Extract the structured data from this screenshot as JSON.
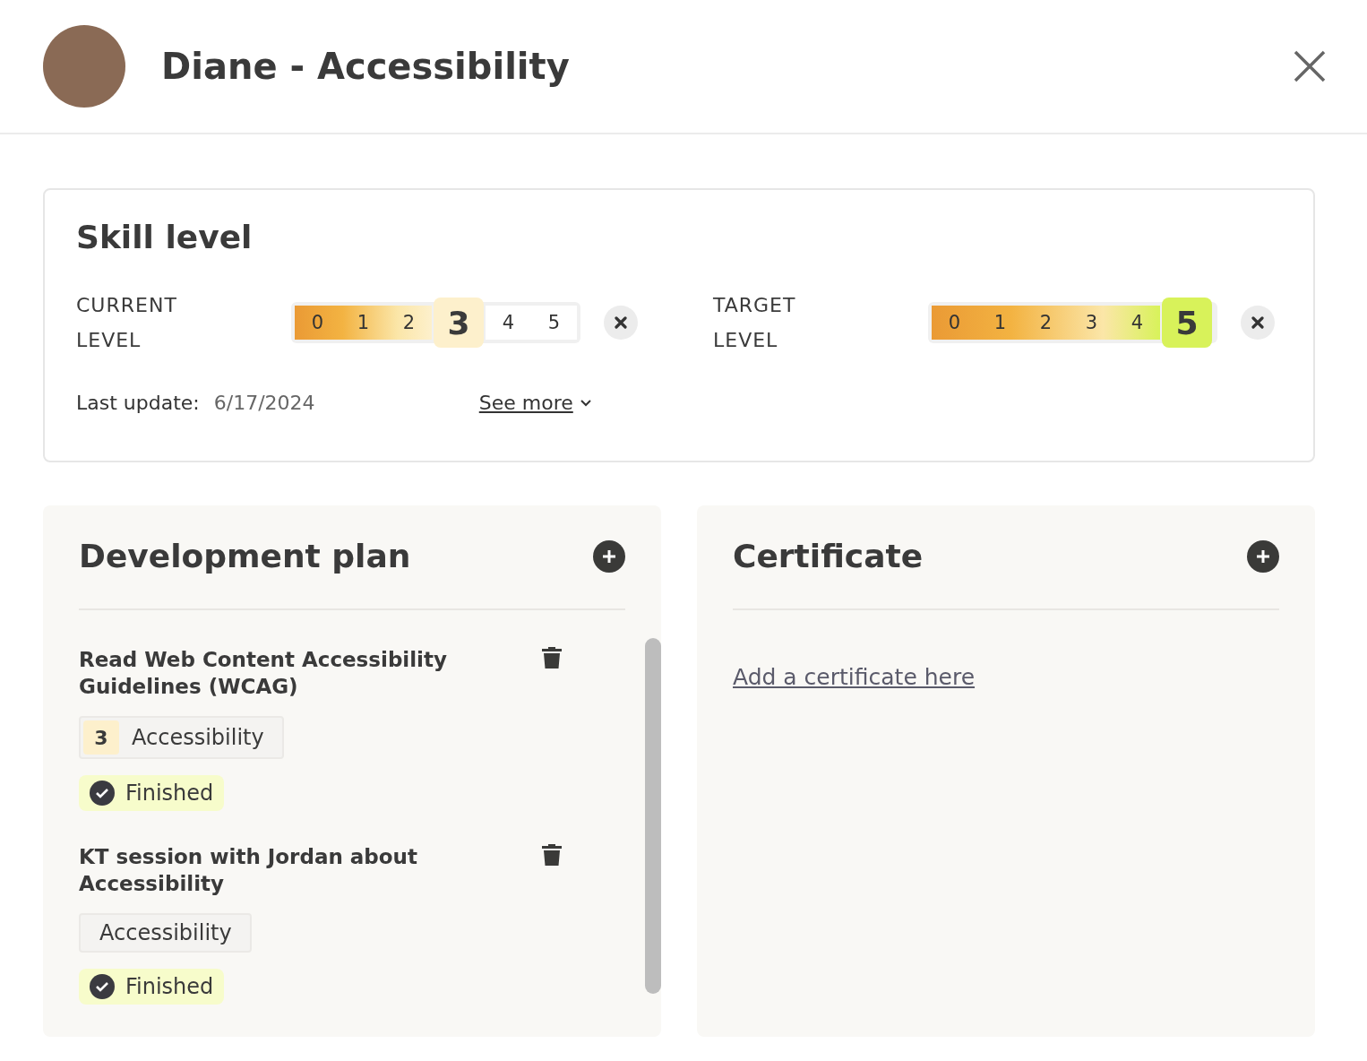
{
  "header": {
    "title": "Diane - Accessibility"
  },
  "skill_level": {
    "title": "Skill level",
    "scales": [
      {
        "label": "CURRENT LEVEL",
        "color": "#fdf0cc",
        "steps": [
          {
            "label": "0",
            "selected": false
          },
          {
            "label": "1",
            "selected": false
          },
          {
            "label": "2",
            "selected": false
          },
          {
            "label": "3",
            "selected": true
          },
          {
            "label": "4",
            "selected": false
          },
          {
            "label": "5",
            "selected": false
          }
        ]
      },
      {
        "label": "TARGET LEVEL",
        "color": "#d8f25a",
        "steps": [
          {
            "label": "0",
            "selected": false
          },
          {
            "label": "1",
            "selected": false
          },
          {
            "label": "2",
            "selected": false
          },
          {
            "label": "3",
            "selected": false
          },
          {
            "label": "4",
            "selected": false
          },
          {
            "label": "5",
            "selected": true
          }
        ]
      }
    ],
    "last_update_label": "Last update:",
    "last_update": "6/17/2024",
    "see_more": "See more"
  },
  "development_plan": {
    "title": "Development plan",
    "items": [
      {
        "title": "Read Web Content Accessibility Guidelines (WCAG)",
        "tag_level": "3",
        "tag": "Accessibility",
        "status": "Finished",
        "finished": true
      },
      {
        "title": "KT session with Jordan about Accessibility",
        "tag": "Accessibility",
        "status": "Finished",
        "finished": true
      }
    ]
  },
  "certificate": {
    "title": "Certificate",
    "link": "Add a certificate here"
  }
}
